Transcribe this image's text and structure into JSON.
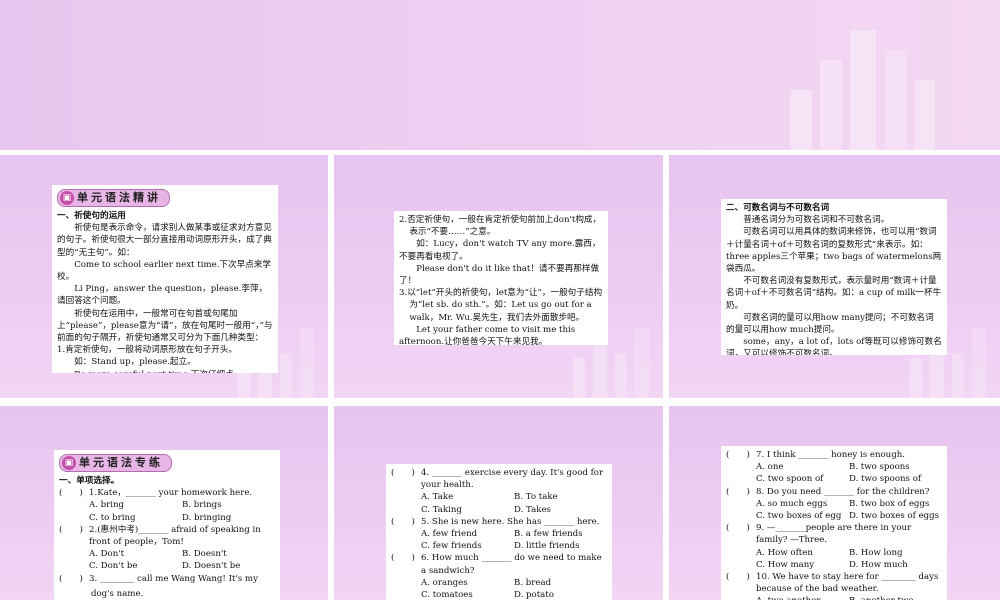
{
  "s1": {
    "banner": "单元语法精讲",
    "lines": [
      {
        "c": "h",
        "t": "一、祈使句的运用"
      },
      {
        "c": "ind",
        "t": "祈使句是表示命令，请求别人做某事或征求对方意见的句子。祈使句很大一部分直接用动词原形开头，成了典型的“无主句”。如："
      },
      {
        "c": "ind",
        "t": "Come to school earlier next time.下次早点来学校。"
      },
      {
        "c": "ind",
        "t": "Li Ping，answer the question，please.李萍，请回答这个问题。"
      },
      {
        "c": "ind",
        "t": "祈使句在运用中，一般常可在句首或句尾加上“please”，please意为“请”，放在句尾时一般用“，”与前面的句子隔开，祈使句通常又可分为下面几种类型："
      },
      {
        "c": "hang",
        "t": "1.肯定祈使句，一般将动词原形放在句子开头。"
      },
      {
        "c": "ind",
        "t": "如：Stand up，please.起立。"
      },
      {
        "c": "ind",
        "t": "Be more careful next time.下次仔细点。"
      }
    ]
  },
  "s2": {
    "lines": [
      {
        "c": "hang",
        "t": "2.否定祈使句，一般在肯定祈使句前加上don't构成，表示“不要……”之意。"
      },
      {
        "c": "ind",
        "t": "如：Lucy，don't watch TV any more.露西，不要再看电视了。"
      },
      {
        "c": "ind",
        "t": "Please don't do it like that！请不要再那样做了！"
      },
      {
        "c": "hang",
        "t": "3.以“let”开头的祈使句，let意为“让”，一般句子结构为“let sb. do sth.”。如：Let us go out for a walk，Mr. Wu.吴先生，我们去外面散步吧。"
      },
      {
        "c": "ind",
        "t": "Let your father come to visit me this afternoon.让你爸爸今天下午来见我。"
      }
    ]
  },
  "s3": {
    "lines": [
      {
        "c": "h",
        "t": "二、可数名词与不可数名词"
      },
      {
        "c": "ind",
        "t": "普通名词分为可数名词和不可数名词。"
      },
      {
        "c": "ind",
        "t": "可数名词可以用具体的数词来修饰，也可以用“数词＋计量名词＋of＋可数名词的复数形式”来表示。如：three apples三个苹果；two bags of watermelons两袋西瓜。"
      },
      {
        "c": "ind",
        "t": "不可数名词没有复数形式，表示量时用“数词＋计量名词＋of＋不可数名词”结构。如：a cup of milk一杯牛奶。"
      },
      {
        "c": "ind",
        "t": "可数名词的量可以用how many提问；不可数名词的量可以用how much提问。"
      },
      {
        "c": "ind",
        "t": "some，any，a lot of，lots of等既可以修饰可数名词，又可以修饰不可数名词。"
      }
    ]
  },
  "s4": {
    "banner": "单元语法专练",
    "section": "一、单项选择。",
    "questions": [
      {
        "p": "(　　)",
        "t": "1.Kate，_______ your homework here.",
        "o": [
          "A. bring",
          "B. brings",
          "C. to bring",
          "D. bringing"
        ]
      },
      {
        "p": "(　　)",
        "t": "2.(惠州中考)_______ afraid of speaking in front of people，Tom!",
        "o": [
          "A. Don't",
          "B. Doesn't",
          "C. Don't be",
          "D. Doesn't be"
        ]
      },
      {
        "p": "(　　)",
        "t": "3. ________ call me Wang Wang! It's my",
        "o": []
      }
    ],
    "overflow": "dog's name."
  },
  "s5": {
    "questions": [
      {
        "p": "(　　)",
        "t": "4. _______ exercise every day. It's good for your health.",
        "o": [
          "A. Take",
          "B. To take",
          "C. Taking",
          "D. Takes"
        ]
      },
      {
        "p": "(　　)",
        "t": "5. She is new here. She has _______ here.",
        "o": [
          "A. few friend",
          "B. a few friends",
          "C. few friends",
          "D. little friends"
        ]
      },
      {
        "p": "(　　)",
        "t": "6. How much _______ do we need to make a sandwich?",
        "o": [
          "A. oranges",
          "B. bread",
          "C. tomatoes",
          "D. potato"
        ]
      }
    ]
  },
  "s6": {
    "questions": [
      {
        "p": "(　　)",
        "t": "7. I think _______ honey is enough.",
        "o": [
          "A. one",
          "B. two spoons",
          "C. two spoon of",
          "D. two spoons of"
        ]
      },
      {
        "p": "(　　)",
        "t": "8. Do you need _______ for the children?",
        "o": [
          "A. so much eggs",
          "B. two box of eggs",
          "C. two boxes of egg",
          "D. two boxes of eggs"
        ]
      },
      {
        "p": "(　　)",
        "t": "9. —_______people are there in your family? —Three.",
        "o": [
          "A. How often",
          "B. How long",
          "C. How many",
          "D. How much"
        ]
      },
      {
        "p": "(　　)",
        "t": "10. We have to stay here for ________ days because of the bad weather.",
        "o": [
          "A. two another",
          "B. another two"
        ]
      }
    ]
  }
}
